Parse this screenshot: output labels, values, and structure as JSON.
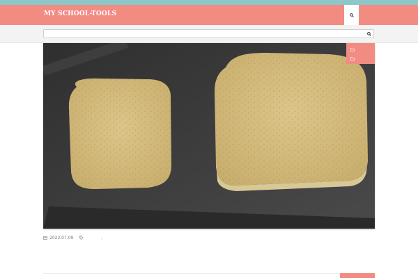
{
  "top_notice": "",
  "header": {
    "logo": "MY SCHOOL-TOOLS",
    "tagline": "",
    "search_icon": "search-icon",
    "menu_icon": "menu-icon",
    "menu_label": ""
  },
  "search": {
    "placeholder": "",
    "icon": "search-icon"
  },
  "post": {
    "categories": [
      {
        "icon": "folder-icon",
        "label": ""
      },
      {
        "icon": "folder-icon",
        "label": ""
      }
    ],
    "date": "2022.07.09",
    "date_icon": "calendar-icon",
    "tag_icon": "tag-icon",
    "tag_separator": ",",
    "title": "",
    "excerpt": ""
  },
  "next_post": {
    "badge": ""
  },
  "colors": {
    "header": "#f28b82",
    "top_strip": "#8cc7c9",
    "accent_text": "#ffffff"
  }
}
